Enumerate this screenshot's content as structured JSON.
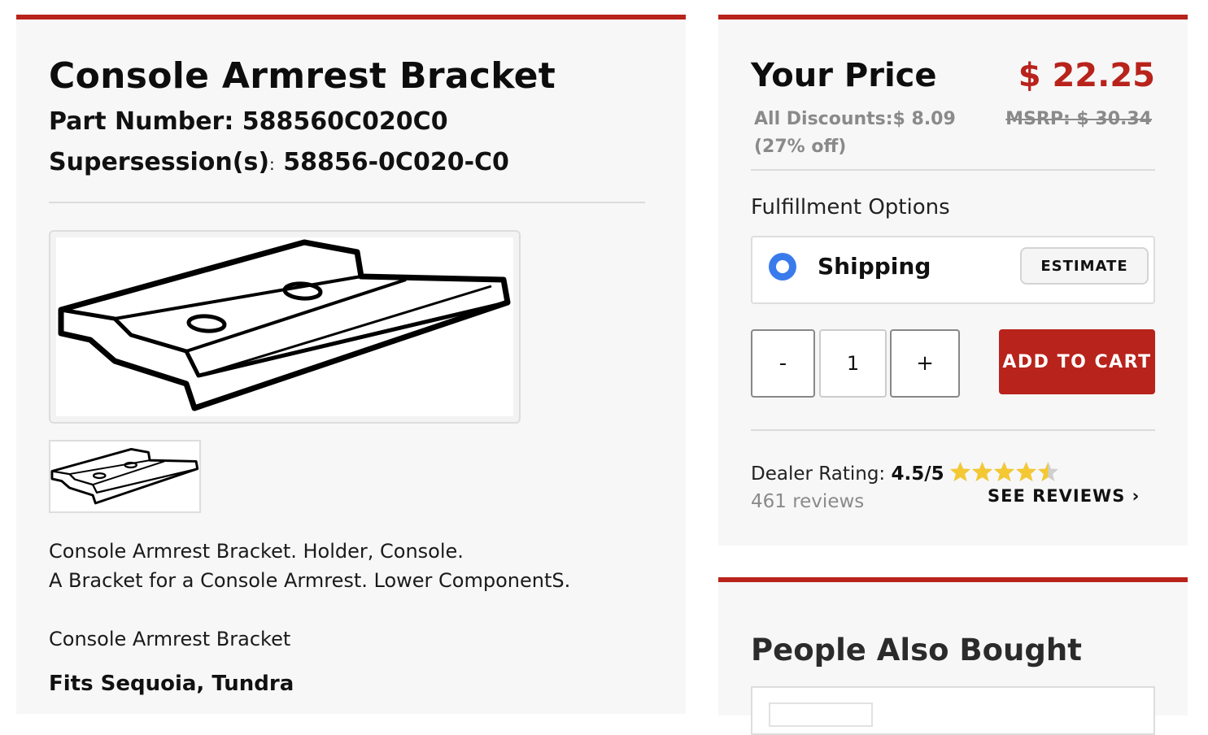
{
  "product": {
    "title": "Console Armrest Bracket",
    "part_number_label": "Part Number:",
    "part_number": "588560C020C0",
    "supersession_label": "Supersession(s)",
    "supersession_colon": ":",
    "supersession": "58856-0C020-C0",
    "image_icon": "bracket-drawing",
    "description_line1": "Console Armrest Bracket. Holder, Console.",
    "description_line2": "A Bracket for a Console Armrest. Lower ComponentS.",
    "description_line3": "Console Armrest Bracket",
    "fits": "Fits Sequoia, Tundra"
  },
  "pricing": {
    "your_price_label": "Your Price",
    "price": "$ 22.25",
    "discounts": "All Discounts:$ 8.09 (27% off)",
    "msrp": "MSRP: $ 30.34"
  },
  "fulfillment": {
    "label": "Fulfillment Options",
    "option": "Shipping",
    "option_selected": true,
    "estimate_label": "ESTIMATE"
  },
  "cart": {
    "minus": "-",
    "quantity": "1",
    "plus": "+",
    "add_label": "ADD TO CART"
  },
  "rating": {
    "label": "Dealer Rating:",
    "value": "4.5/5",
    "stars": 4.5,
    "reviews": "461 reviews",
    "see_reviews": "SEE REVIEWS",
    "chevron": "›"
  },
  "also_bought": {
    "title": "People Also Bought"
  },
  "colors": {
    "accent": "#b8231b",
    "star": "#f3c833",
    "radio": "#3a7bec"
  }
}
